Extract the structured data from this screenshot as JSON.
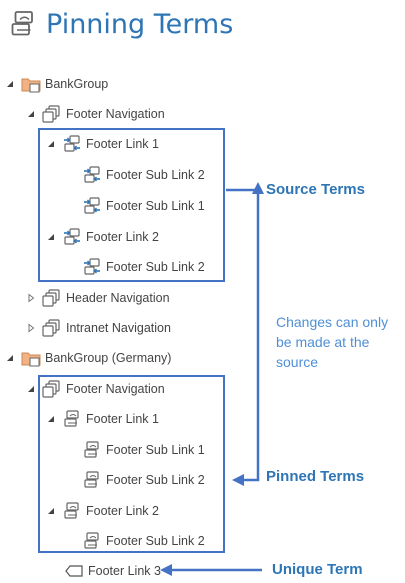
{
  "title": "Pinning Terms",
  "tree": {
    "bankgroup": "BankGroup",
    "footer_nav": "Footer Navigation",
    "footer_link_1": "Footer Link 1",
    "sub_link_2_a": "Footer Sub Link 2",
    "sub_link_1_a": "Footer Sub Link 1",
    "footer_link_2": "Footer Link 2",
    "sub_link_2_b": "Footer Sub Link 2",
    "header_nav": "Header Navigation",
    "intranet_nav": "Intranet Navigation",
    "bankgroup_de": "BankGroup (Germany)",
    "footer_nav_de": "Footer Navigation",
    "footer_link_1_de": "Footer Link 1",
    "sub_link_1_de": "Footer Sub Link 1",
    "sub_link_2_de": "Footer Sub Link 2",
    "footer_link_2_de": "Footer Link 2",
    "sub_link_2_de_b": "Footer Sub Link 2",
    "footer_link_3": "Footer Link 3"
  },
  "annotations": {
    "source_terms": "Source Terms",
    "note_line1": "Changes can only",
    "note_line2": "be made at the",
    "note_line3": "source",
    "pinned_terms": "Pinned Terms",
    "unique_term": "Unique Term"
  },
  "colors": {
    "accent": "#2e75b6",
    "box": "#4472c4",
    "folder": "#f4b183"
  }
}
